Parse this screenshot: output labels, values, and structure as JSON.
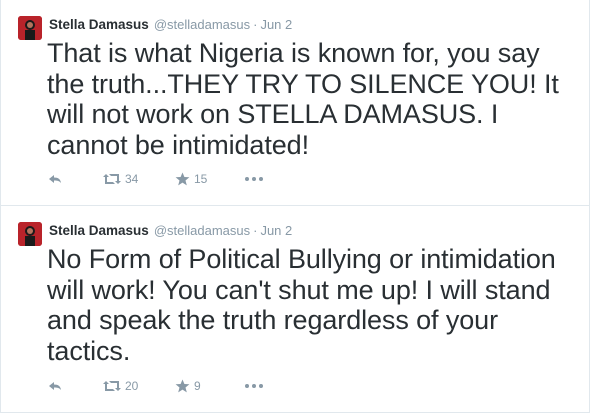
{
  "colors": {
    "text": "#292f33",
    "meta": "#8899a6",
    "divider": "#e1e8ed",
    "avatar_bg": "#b9232a"
  },
  "tweets": [
    {
      "fullname": "Stella Damasus",
      "username": "@stelladamasus",
      "separator": "·",
      "time": "Jun 2",
      "text": "That is what Nigeria is known for, you say the truth...THEY TRY TO SILENCE YOU! It will not work on STELLA DAMASUS. I cannot be intimidated!",
      "retweets": "34",
      "favorites": "15",
      "icons": [
        "reply-icon",
        "retweet-icon",
        "favorite-icon",
        "more-icon"
      ]
    },
    {
      "fullname": "Stella Damasus",
      "username": "@stelladamasus",
      "separator": "·",
      "time": "Jun 2",
      "text": "No Form of Political Bullying or intimidation will work! You can't shut me up! I will stand and speak the truth regardless of your tactics.",
      "retweets": "20",
      "favorites": "9",
      "icons": [
        "reply-icon",
        "retweet-icon",
        "favorite-icon",
        "more-icon"
      ]
    }
  ]
}
